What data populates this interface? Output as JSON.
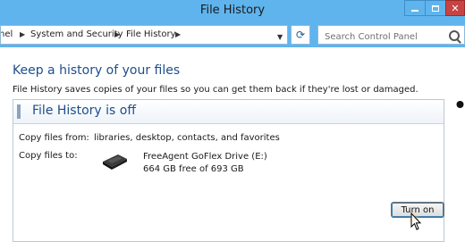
{
  "window": {
    "title": "File History"
  },
  "address_bar": {
    "crumbs": [
      "nel",
      "System and Security",
      "File History"
    ],
    "search_placeholder": "Search Control Panel"
  },
  "main": {
    "heading": "Keep a history of your files",
    "description": "File History saves copies of your files so you can get them back if they're lost or damaged.",
    "status_title": "File History is off",
    "copy_from_label": "Copy files from:",
    "copy_from_value": "libraries, desktop, contacts, and favorites",
    "copy_to_label": "Copy files to:",
    "drive_name": "FreeAgent GoFlex Drive (E:)",
    "drive_space": "664 GB free of 693 GB",
    "turn_on_label": "Turn on"
  },
  "colors": {
    "chrome_blue": "#5fb4ed",
    "heading_blue": "#1e4e8c",
    "close_red": "#c74343"
  },
  "icons": [
    "minimize-icon",
    "maximize-icon",
    "close-icon",
    "chevron-right-icon",
    "chevron-down-icon",
    "refresh-icon",
    "search-icon",
    "external-drive-icon",
    "cursor-icon"
  ]
}
